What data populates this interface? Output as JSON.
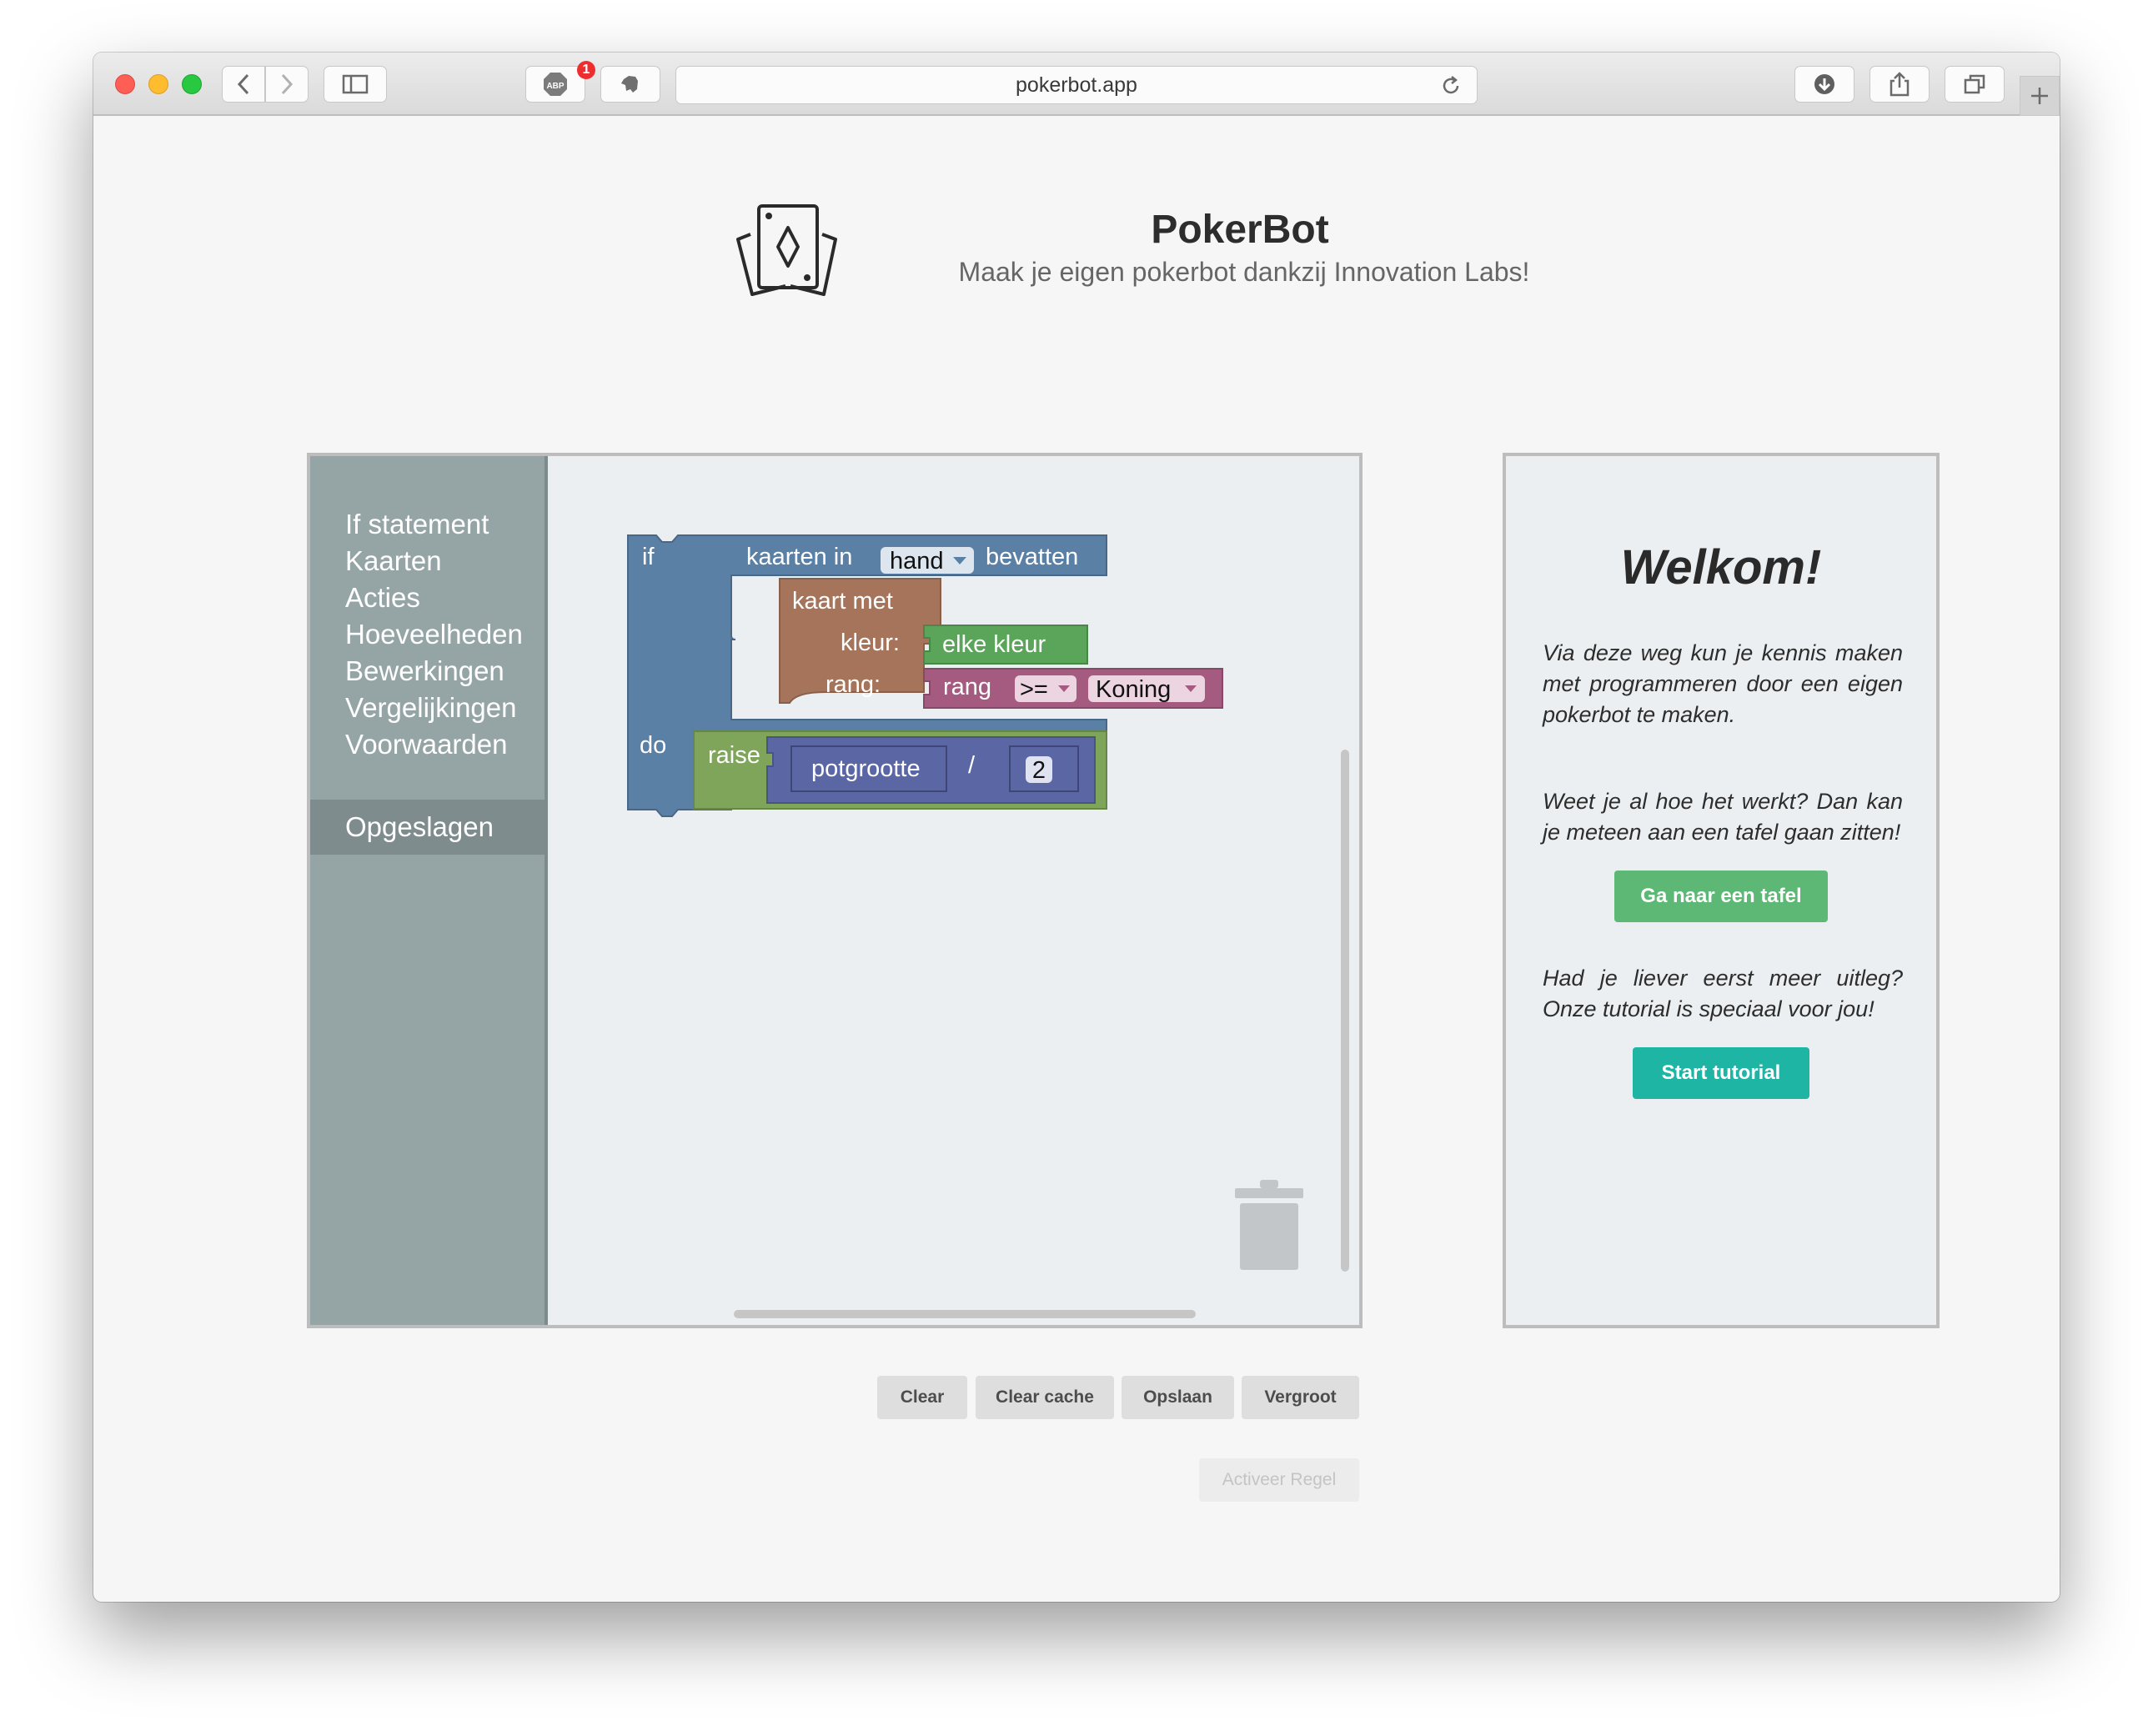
{
  "browser": {
    "url": "pokerbot.app",
    "abp_label": "ABP",
    "abp_badge": "1"
  },
  "header": {
    "title": "PokerBot",
    "subtitle": "Maak je eigen pokerbot dankzij Innovation Labs!",
    "logo_icon": "playing-cards-icon"
  },
  "toolbox": {
    "categories": [
      "If statement",
      "Kaarten",
      "Acties",
      "Hoeveelheden",
      "Bewerkingen",
      "Vergelijkingen",
      "Voorwaarden"
    ],
    "saved": "Opgeslagen",
    "color": "#95a5a6"
  },
  "blocks": {
    "if_label": "if",
    "do_label": "do",
    "cards_in": "kaarten in",
    "hand_dropdown": "hand",
    "contain": "bevatten",
    "card_with": "kaart met",
    "suit_label": "kleur:",
    "suit_value": "elke kleur",
    "rank_label": "rang:",
    "rank_word": "rang",
    "operator": ">=",
    "rank_value": "Koning",
    "action": "raise",
    "variable": "potgrootte",
    "divide": "/",
    "number": "2",
    "colors": {
      "logic": "#5b80a5",
      "card": "#a5745b",
      "suit": "#5ba55b",
      "rank": "#a55b80",
      "action": "#7fa55b",
      "math": "#5b67a5"
    }
  },
  "welcome": {
    "heading": "Welkom!",
    "intro": "Via deze weg kun je kennis maken met programmeren door een eigen pokerbot te maken.",
    "question1": "Weet je al hoe het werkt? Dan kan je meteen aan een tafel gaan zitten!",
    "button_table": "Ga naar een tafel",
    "question2": "Had je liever eerst meer uitleg? Onze tutorial is speciaal voor jou!",
    "button_tutorial": "Start tutorial",
    "colors": {
      "table_button": "#5cb874",
      "tutorial_button": "#1fb5a5"
    }
  },
  "actions": {
    "clear": "Clear",
    "clear_cache": "Clear cache",
    "save": "Opslaan",
    "enlarge": "Vergroot",
    "activate": "Activeer Regel"
  }
}
